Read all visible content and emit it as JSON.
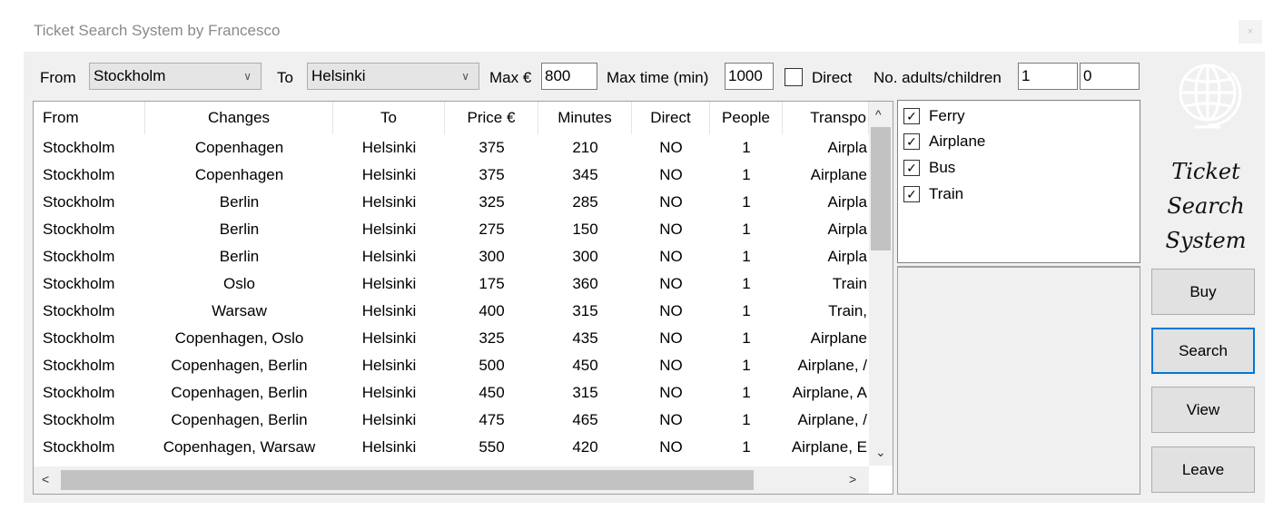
{
  "window": {
    "title": "Ticket Search System by Francesco",
    "close": "×"
  },
  "toolbar": {
    "from_label": "From",
    "from_value": "Stockholm",
    "to_label": "To",
    "to_value": "Helsinki",
    "max_price_label": "Max €",
    "max_price_value": "800",
    "max_time_label": "Max time (min)",
    "max_time_value": "1000",
    "direct_label": "Direct",
    "direct_checked": false,
    "people_label": "No. adults/children",
    "adults_value": "1",
    "children_value": "0"
  },
  "table": {
    "columns": [
      "From",
      "Changes",
      "To",
      "Price €",
      "Minutes",
      "Direct",
      "People",
      "Transpo"
    ],
    "rows": [
      [
        "Stockholm",
        "Copenhagen",
        "Helsinki",
        "375",
        "210",
        "NO",
        "1",
        "Airpla"
      ],
      [
        "Stockholm",
        "Copenhagen",
        "Helsinki",
        "375",
        "345",
        "NO",
        "1",
        "Airplane"
      ],
      [
        "Stockholm",
        "Berlin",
        "Helsinki",
        "325",
        "285",
        "NO",
        "1",
        "Airpla"
      ],
      [
        "Stockholm",
        "Berlin",
        "Helsinki",
        "275",
        "150",
        "NO",
        "1",
        "Airpla"
      ],
      [
        "Stockholm",
        "Berlin",
        "Helsinki",
        "300",
        "300",
        "NO",
        "1",
        "Airpla"
      ],
      [
        "Stockholm",
        "Oslo",
        "Helsinki",
        "175",
        "360",
        "NO",
        "1",
        "Train"
      ],
      [
        "Stockholm",
        "Warsaw",
        "Helsinki",
        "400",
        "315",
        "NO",
        "1",
        "Train,"
      ],
      [
        "Stockholm",
        "Copenhagen, Oslo",
        "Helsinki",
        "325",
        "435",
        "NO",
        "1",
        "Airplane"
      ],
      [
        "Stockholm",
        "Copenhagen, Berlin",
        "Helsinki",
        "500",
        "450",
        "NO",
        "1",
        "Airplane, /"
      ],
      [
        "Stockholm",
        "Copenhagen, Berlin",
        "Helsinki",
        "450",
        "315",
        "NO",
        "1",
        "Airplane, A"
      ],
      [
        "Stockholm",
        "Copenhagen, Berlin",
        "Helsinki",
        "475",
        "465",
        "NO",
        "1",
        "Airplane, /"
      ],
      [
        "Stockholm",
        "Copenhagen, Warsaw",
        "Helsinki",
        "550",
        "420",
        "NO",
        "1",
        "Airplane, E"
      ]
    ]
  },
  "transport_filters": [
    {
      "label": "Ferry",
      "checked": true
    },
    {
      "label": "Airplane",
      "checked": true
    },
    {
      "label": "Bus",
      "checked": true
    },
    {
      "label": "Train",
      "checked": true
    }
  ],
  "logo": {
    "icon": "globe-icon",
    "line1": "Ticket",
    "line2": "Search",
    "line3": "System"
  },
  "buttons": {
    "buy": "Buy",
    "search": "Search",
    "view": "View",
    "leave": "Leave"
  },
  "icons": {
    "check": "✓",
    "chevron_down": "∨",
    "arrow_up": "^",
    "arrow_down": "⌄",
    "arrow_left": "<",
    "arrow_right": ">"
  }
}
